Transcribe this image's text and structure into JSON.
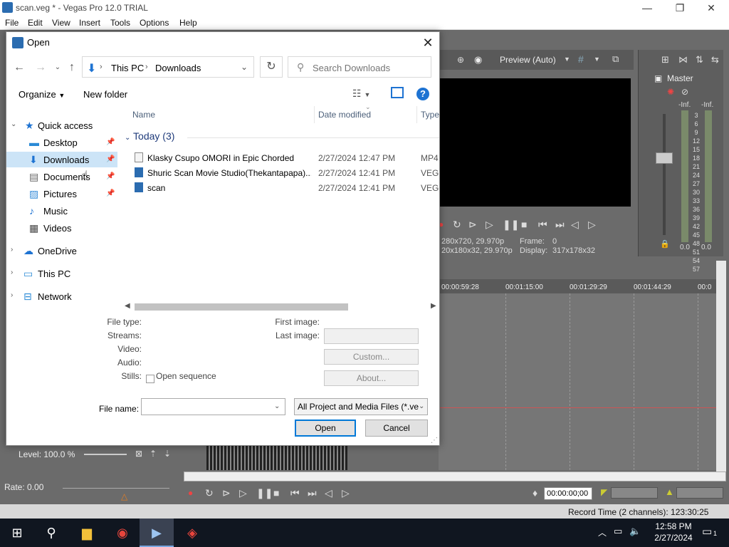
{
  "vegas": {
    "title": "scan.veg * - Vegas Pro 12.0 TRIAL",
    "menu": [
      "File",
      "Edit",
      "View",
      "Insert",
      "Tools",
      "Options",
      "Help"
    ],
    "preview_mode": "Preview (Auto)",
    "preview_info": {
      "project": "280x720, 29.970p",
      "frame_label": "Frame:",
      "frame_value": "0",
      "preview": "20x180x32, 29.970p",
      "display_label": "Display:",
      "display_value": "317x178x32"
    },
    "mixer": {
      "master_label": "Master",
      "inf_left": "-Inf.",
      "inf_right": "-Inf.",
      "scale": [
        "3",
        "6",
        "9",
        "12",
        "15",
        "18",
        "21",
        "24",
        "27",
        "30",
        "33",
        "36",
        "39",
        "42",
        "45",
        "48",
        "51",
        "54",
        "57"
      ],
      "zero_left": "0.0",
      "zero_right": "0.0"
    },
    "ruler_times": [
      "00:00:59:28",
      "00:01:15:00",
      "00:01:29:29",
      "00:01:44:29",
      "00:0"
    ],
    "level": "Level: 100.0 %",
    "rate": "Rate: 0.00",
    "timecode": "00:00:00;00",
    "record_time": "Record Time (2 channels): 123:30:25"
  },
  "dialog": {
    "title": "Open",
    "breadcrumb": [
      "This PC",
      "Downloads"
    ],
    "search_placeholder": "Search Downloads",
    "organize": "Organize",
    "new_folder": "New folder",
    "nav": {
      "quick_access": "Quick access",
      "items": [
        {
          "label": "Desktop",
          "icon": "desktop-icon",
          "pinned": true
        },
        {
          "label": "Downloads",
          "icon": "download-icon",
          "pinned": true,
          "selected": true
        },
        {
          "label": "Documents",
          "icon": "document-icon",
          "pinned": true
        },
        {
          "label": "Pictures",
          "icon": "pictures-icon",
          "pinned": true
        },
        {
          "label": "Music",
          "icon": "music-icon",
          "pinned": false
        },
        {
          "label": "Videos",
          "icon": "video-icon",
          "pinned": false
        }
      ],
      "onedrive": "OneDrive",
      "this_pc": "This PC",
      "network": "Network"
    },
    "columns": {
      "name": "Name",
      "date_modified": "Date modified",
      "type": "Type"
    },
    "group": "Today (3)",
    "files": [
      {
        "name": "Klasky Csupo OMORI in Epic Chorded",
        "date": "2/27/2024 12:47 PM",
        "type": "MP4"
      },
      {
        "name": "Shuric Scan Movie Studio(Thekantapapa)...",
        "date": "2/27/2024 12:41 PM",
        "type": "VEG F"
      },
      {
        "name": "scan",
        "date": "2/27/2024 12:41 PM",
        "type": "VEG F"
      }
    ],
    "props": {
      "file_type": "File type:",
      "streams": "Streams:",
      "video": "Video:",
      "audio": "Audio:",
      "stills": "Stills:",
      "open_sequence": "Open sequence",
      "first_image": "First image:",
      "last_image": "Last image:",
      "custom": "Custom...",
      "about": "About..."
    },
    "file_name_label": "File name:",
    "file_name_value": "",
    "filter": "All Project and Media Files (*.ve",
    "open": "Open",
    "cancel": "Cancel"
  },
  "taskbar": {
    "time": "12:58 PM",
    "date": "2/27/2024",
    "notifications": "1"
  }
}
